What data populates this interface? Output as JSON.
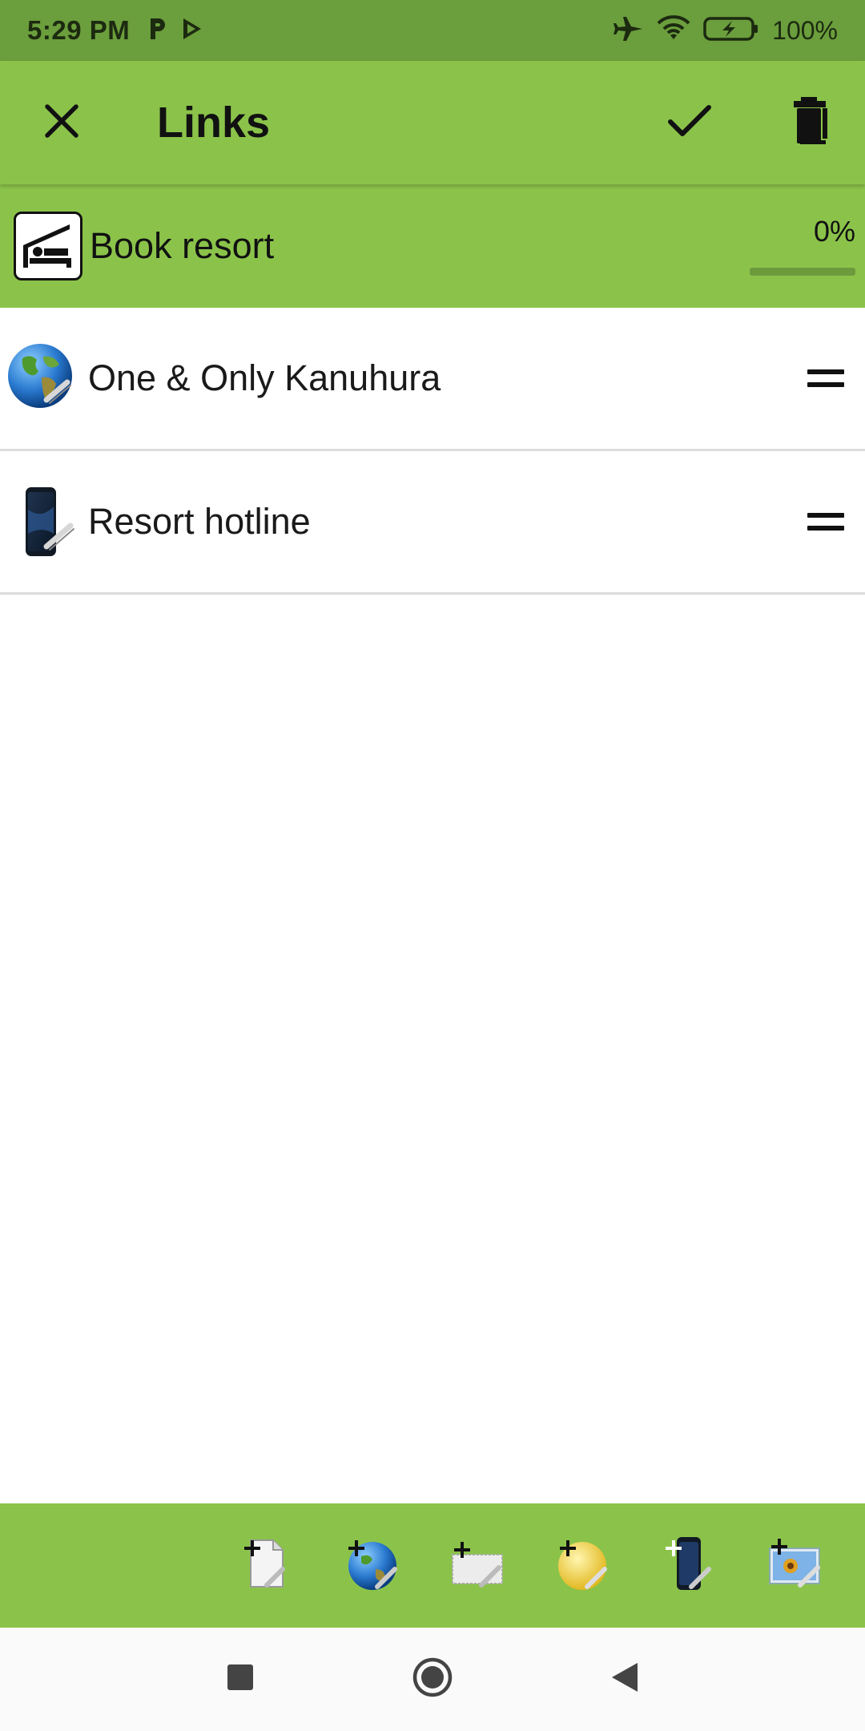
{
  "status_bar": {
    "time": "5:29 PM",
    "battery": "100%",
    "icons": [
      "p-app-icon",
      "play-store-icon",
      "airplane-mode-icon",
      "wifi-icon",
      "battery-charging-icon"
    ]
  },
  "app_bar": {
    "title": "Links",
    "close_icon": "close-icon",
    "confirm_icon": "check-icon",
    "delete_icon": "trash-icon"
  },
  "task": {
    "title": "Book resort",
    "icon": "hotel-bed-icon",
    "progress_text": "0%",
    "progress": 0
  },
  "links": [
    {
      "label": "One & Only Kanuhura",
      "icon": "globe-link-icon"
    },
    {
      "label": "Resort hotline",
      "icon": "phone-link-icon"
    }
  ],
  "toolbar": {
    "buttons": [
      {
        "name": "add-file-link-button",
        "icon": "file-link-icon"
      },
      {
        "name": "add-web-link-button",
        "icon": "globe-link-icon"
      },
      {
        "name": "add-email-link-button",
        "icon": "mail-link-icon"
      },
      {
        "name": "add-contact-link-button",
        "icon": "contact-link-icon"
      },
      {
        "name": "add-phone-link-button",
        "icon": "phone-link-icon"
      },
      {
        "name": "add-image-link-button",
        "icon": "image-link-icon"
      }
    ]
  },
  "nav_bar": {
    "icons": [
      "recents-square-icon",
      "home-circle-icon",
      "back-triangle-icon"
    ]
  },
  "colors": {
    "status_bar": "#6b9e3c",
    "accent": "#8bc34a",
    "text": "#111111",
    "divider": "#dcdcdc"
  }
}
